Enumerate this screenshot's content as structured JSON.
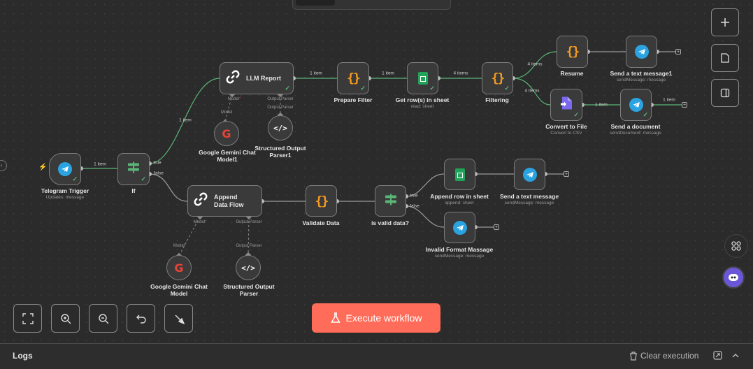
{
  "canvas": {
    "nodes": [
      {
        "id": "telegram-trigger",
        "label": "Telegram Trigger",
        "sub": "Updates: message",
        "icon": "telegram-icon"
      },
      {
        "id": "if",
        "label": "If",
        "sub": "",
        "icon": "if-icon",
        "outputs": [
          "true",
          "false"
        ]
      },
      {
        "id": "llm-report",
        "label": "LLM Report",
        "icon": "chain-link-icon"
      },
      {
        "id": "prepare-filter",
        "label": "Prepare Filter",
        "icon": "code-braces-icon"
      },
      {
        "id": "get-rows",
        "label": "Get row(s) in sheet",
        "sub": "read: sheet",
        "icon": "google-sheets-icon"
      },
      {
        "id": "filtering",
        "label": "Filtering",
        "icon": "code-braces-icon"
      },
      {
        "id": "resume",
        "label": "Resume",
        "icon": "code-braces-icon"
      },
      {
        "id": "send-text-1",
        "label": "Send a text message1",
        "sub": "sendMessage: message",
        "icon": "telegram-icon"
      },
      {
        "id": "convert-to-file",
        "label": "Convert to File",
        "sub": "Convert to CSV",
        "icon": "convert-file-icon"
      },
      {
        "id": "send-document",
        "label": "Send a document",
        "sub": "sendDocument: message",
        "icon": "telegram-icon"
      },
      {
        "id": "gemini-1",
        "label": "Google Gemini Chat Model1",
        "icon": "google-icon"
      },
      {
        "id": "parser-1",
        "label": "Structured Output Parser1",
        "icon": "code-icon"
      },
      {
        "id": "append-data-flow",
        "label": "Append Data Flow",
        "icon": "chain-link-icon"
      },
      {
        "id": "validate-data",
        "label": "Validate Data",
        "icon": "code-braces-icon"
      },
      {
        "id": "is-valid",
        "label": "is valid data?",
        "icon": "if-icon",
        "outputs": [
          "true",
          "false"
        ]
      },
      {
        "id": "append-row",
        "label": "Append row in sheet",
        "sub": "append: sheet",
        "icon": "google-sheets-icon"
      },
      {
        "id": "send-text",
        "label": "Send a text message",
        "sub": "sendMessage: message",
        "icon": "telegram-icon"
      },
      {
        "id": "invalid-format",
        "label": "Invalid Format Massage",
        "sub": "sendMessage: message",
        "icon": "telegram-icon"
      },
      {
        "id": "gemini-2",
        "label": "Google Gemini Chat Model",
        "icon": "google-icon"
      },
      {
        "id": "parser-2",
        "label": "Structured Output Parser",
        "icon": "code-icon"
      }
    ],
    "edge_labels": {
      "trigger_if": "1 item",
      "if_llm": "1 item",
      "llm_prepare": "1 item",
      "prepare_get": "1 item",
      "get_filter": "4 items",
      "filter_resume": "4 items",
      "filter_convert": "4 items",
      "convert_send": "1 item",
      "send_plus": "1 item"
    },
    "handles": {
      "model": "Model",
      "output_parser": "Output Parser",
      "required": "*"
    }
  },
  "right_toolbar": [
    "add-node-icon",
    "sticky-note-icon",
    "panel-toggle-icon"
  ],
  "controls": {
    "buttons": [
      "fit-view-icon",
      "zoom-in-icon",
      "zoom-out-icon",
      "undo-icon",
      "tidy-up-icon"
    ],
    "execute_label": "Execute workflow"
  },
  "logs": {
    "title": "Logs",
    "clear_label": "Clear execution"
  },
  "colors": {
    "accent": "#ff6d5a",
    "success": "#5ab676",
    "telegram": "#2aa3e0",
    "sheets": "#22a35a",
    "code": "#f59b21"
  }
}
